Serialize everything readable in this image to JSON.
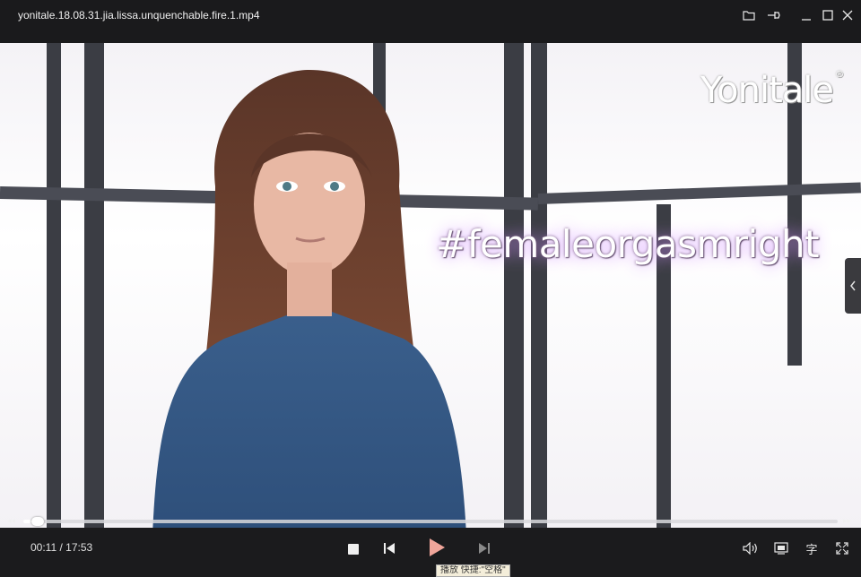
{
  "window": {
    "title": "yonitale.18.08.31.jia.lissa.unquenchable.fire.1.mp4"
  },
  "video": {
    "watermark": "Yonitale",
    "watermark_mark": "®",
    "hashtag": "#femaleorgasmright"
  },
  "playback": {
    "current_time": "00:11",
    "duration": "17:53",
    "time_display": "00:11 / 17:53",
    "progress_fraction": 0.0103
  },
  "tooltip": {
    "text": "播放 快捷:\"空格\""
  },
  "controls": {
    "subtitle_label": "字"
  },
  "colors": {
    "play_accent": "#f0a59a",
    "bar_bg": "#1b1b1d"
  }
}
